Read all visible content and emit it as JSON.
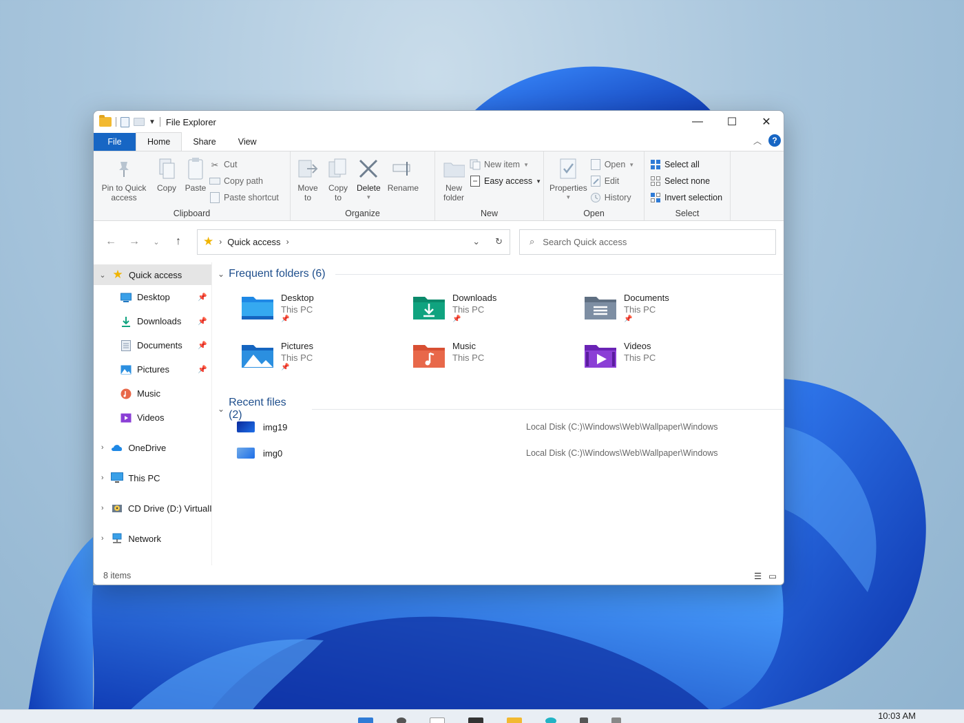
{
  "window": {
    "title": "File Explorer"
  },
  "tabs": {
    "file": "File",
    "home": "Home",
    "share": "Share",
    "view": "View"
  },
  "ribbon": {
    "clipboard": {
      "label": "Clipboard",
      "pin": "Pin to Quick access",
      "copy": "Copy",
      "paste": "Paste",
      "cut": "Cut",
      "copy_path": "Copy path",
      "paste_shortcut": "Paste shortcut"
    },
    "organize": {
      "label": "Organize",
      "move_to": "Move to",
      "copy_to": "Copy to",
      "delete": "Delete",
      "rename": "Rename"
    },
    "new": {
      "label": "New",
      "new_folder": "New folder",
      "new_item": "New item",
      "easy_access": "Easy access"
    },
    "open": {
      "label": "Open",
      "properties": "Properties",
      "open": "Open",
      "edit": "Edit",
      "history": "History"
    },
    "select": {
      "label": "Select",
      "select_all": "Select all",
      "select_none": "Select none",
      "invert": "Invert selection"
    }
  },
  "address": {
    "crumb": "Quick access",
    "search_placeholder": "Search Quick access"
  },
  "nav": {
    "quick_access": "Quick access",
    "pinned": [
      {
        "label": "Desktop",
        "icon": "desktop-icon"
      },
      {
        "label": "Downloads",
        "icon": "download-icon"
      },
      {
        "label": "Documents",
        "icon": "documents-icon"
      },
      {
        "label": "Pictures",
        "icon": "pictures-icon"
      }
    ],
    "unpinned": [
      {
        "label": "Music",
        "icon": "music-icon"
      },
      {
        "label": "Videos",
        "icon": "videos-icon"
      }
    ],
    "roots": [
      {
        "label": "OneDrive",
        "icon": "cloud-icon"
      },
      {
        "label": "This PC",
        "icon": "computer-icon"
      },
      {
        "label": "CD Drive (D:) VirtualI",
        "icon": "cd-drive-icon"
      },
      {
        "label": "Network",
        "icon": "network-icon"
      }
    ]
  },
  "frequent": {
    "heading": "Frequent folders (6)",
    "items": [
      {
        "name": "Desktop",
        "sub": "This PC",
        "pinned": true,
        "color": "#1e88e5"
      },
      {
        "name": "Downloads",
        "sub": "This PC",
        "pinned": true,
        "color": "#10a37f"
      },
      {
        "name": "Documents",
        "sub": "This PC",
        "pinned": true,
        "color": "#7d8ea3"
      },
      {
        "name": "Pictures",
        "sub": "This PC",
        "pinned": true,
        "color": "#2b8fe0"
      },
      {
        "name": "Music",
        "sub": "This PC",
        "pinned": false,
        "color": "#e8684a"
      },
      {
        "name": "Videos",
        "sub": "This PC",
        "pinned": false,
        "color": "#8b3fd6"
      }
    ]
  },
  "recent": {
    "heading": "Recent files (2)",
    "items": [
      {
        "name": "img19",
        "path": "Local Disk (C:)\\Windows\\Web\\Wallpaper\\Windows"
      },
      {
        "name": "img0",
        "path": "Local Disk (C:)\\Windows\\Web\\Wallpaper\\Windows"
      }
    ]
  },
  "status": {
    "count": "8 items"
  },
  "taskbar": {
    "clock": "10:03 AM"
  },
  "colors": {
    "accent": "#1766c4",
    "heading": "#1e4e8c"
  }
}
